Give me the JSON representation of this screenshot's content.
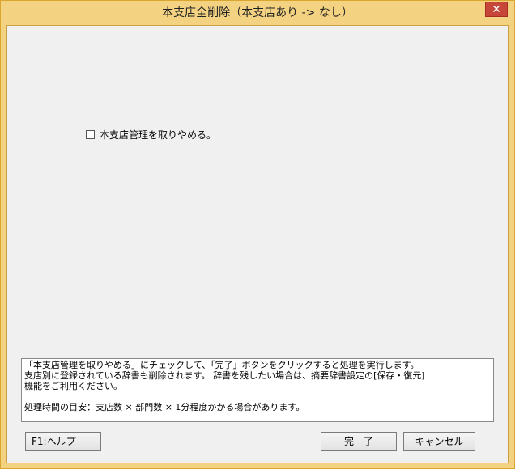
{
  "window": {
    "title": "本支店全削除（本支店あり -> なし）",
    "close_glyph": "✕"
  },
  "checkbox": {
    "label": "本支店管理を取りやめる。",
    "checked": false
  },
  "info": {
    "lines": [
      "「本支店管理を取りやめる」にチェックして、「完了」ボタンをクリックすると処理を実行します。",
      "支店別に登録されている辞書も削除されます。 辞書を残したい場合は、摘要辞書設定の[保存・復元]",
      "機能をご利用ください。"
    ],
    "time_note": "処理時間の目安：支店数 × 部門数 × 1分程度かかる場合があります。"
  },
  "buttons": {
    "help": "F1:ヘルプ",
    "done": "完　了",
    "cancel": "キャンセル"
  },
  "colors": {
    "frame": "#f3d382",
    "close": "#c7463a",
    "client": "#f0f0f0"
  }
}
